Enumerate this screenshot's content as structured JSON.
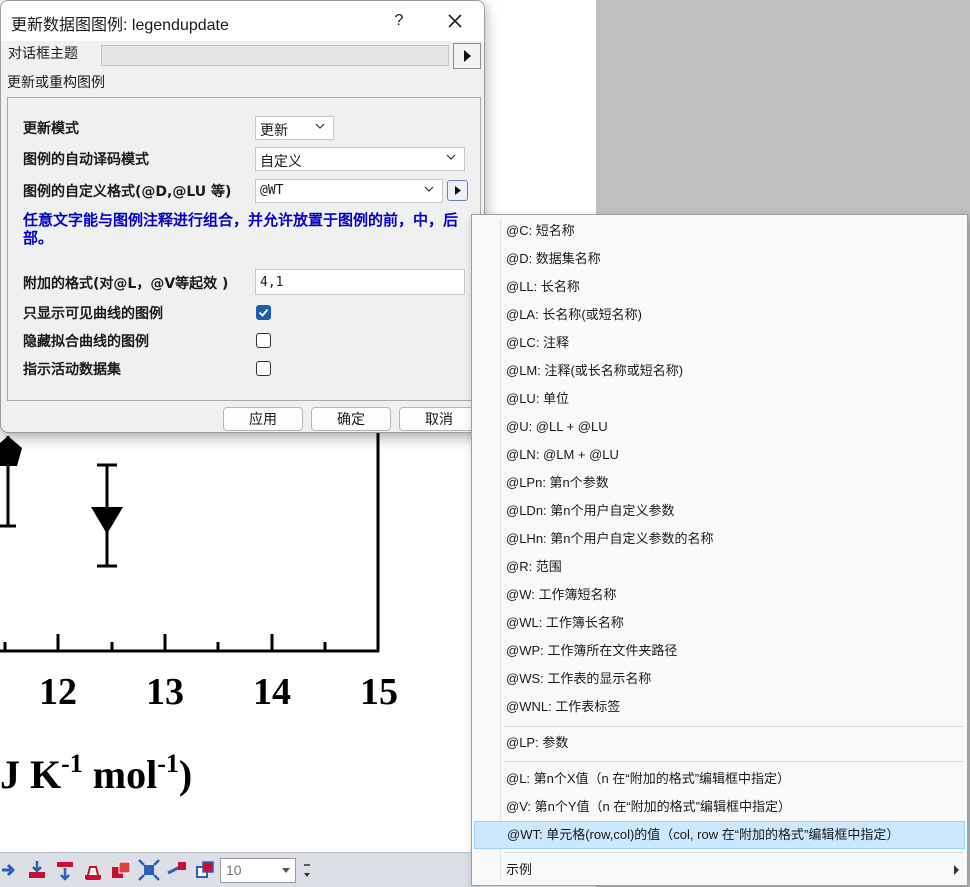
{
  "graph": {
    "x_ticks": [
      "12",
      "13",
      "14",
      "15"
    ],
    "axis_title_main": "J K",
    "axis_title_sup1": "-1",
    "axis_title_mid": " mol",
    "axis_title_sup2": "-1",
    "axis_title_end": ")"
  },
  "toolbar": {
    "zoom_value": "10",
    "icons": [
      "arrange-icon",
      "move-to-front-icon",
      "move-to-back-icon",
      "move-forward-icon",
      "bring-forward-icon",
      "fit-icon",
      "align-icon",
      "group-icon"
    ]
  },
  "dialog": {
    "title": "更新数据图图例: legendupdate",
    "help_label": "?",
    "theme_label": "对话框主题",
    "section_label": "更新或重构图例",
    "update_mode_label": "更新模式",
    "update_mode_value": "更新",
    "auto_translate_label": "图例的自动译码模式",
    "auto_translate_value": "自定义",
    "custom_format_label": "图例的自定义格式(@D,@LU 等)",
    "custom_format_value": "@WT",
    "hint": "任意文字能与图例注释进行组合，并允许放置于图例的前，中，后部。",
    "extra_format_label": "附加的格式(对@L，@V等起效 )",
    "extra_format_value": "4,1",
    "visible_only_label": "只显示可见曲线的图例",
    "visible_only_checked": true,
    "hide_fit_label": "隐藏拟合曲线的图例",
    "hide_fit_checked": false,
    "indicate_active_label": "指示活动数据集",
    "indicate_active_checked": false,
    "apply_label": "应用",
    "ok_label": "确定",
    "cancel_label": "取消"
  },
  "menu": {
    "items": [
      "@C: 短名称",
      "@D: 数据集名称",
      "@LL: 长名称",
      "@LA: 长名称(或短名称)",
      "@LC: 注释",
      "@LM: 注释(或长名称或短名称)",
      "@LU: 单位",
      "@U: @LL + @LU",
      "@LN: @LM + @LU",
      "@LPn: 第n个参数",
      "@LDn: 第n个用户自定义参数",
      "@LHn: 第n个用户自定义参数的名称",
      "@R: 范围",
      "@W: 工作簿短名称",
      "@WL: 工作簿长名称",
      "@WP: 工作簿所在文件夹路径",
      "@WS: 工作表的显示名称",
      "@WNL: 工作表标签"
    ],
    "item_lp": "@LP: 参数",
    "item_l": "@L: 第n个X值（n 在“附加的格式”编辑框中指定）",
    "item_v": "@V: 第n个Y值（n 在“附加的格式”编辑框中指定）",
    "item_wt": "@WT: 单元格(row,col)的值（col, row 在“附加的格式”编辑框中指定）",
    "item_examples": "示例"
  },
  "colors": {
    "hint_blue": "#0000c8",
    "checkbox_blue": "#1a5fb4",
    "menu_highlight": "#cce8ff"
  }
}
